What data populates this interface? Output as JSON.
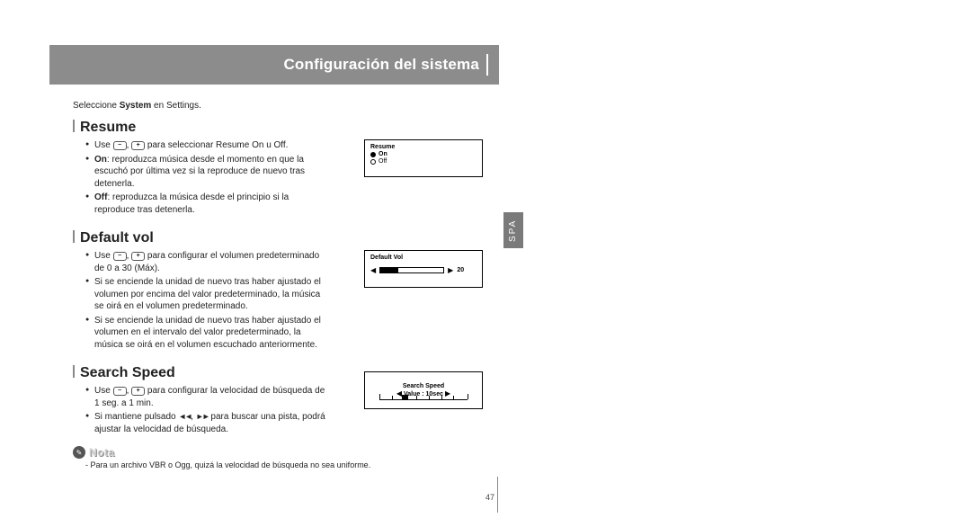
{
  "header": {
    "title": "Configuración del sistema"
  },
  "intro": {
    "prefix": "Seleccione ",
    "bold": "System",
    "suffix": " en Settings."
  },
  "spa_tab": "SPA",
  "page_number": "47",
  "icons": {
    "minus": "−",
    "plus": "+",
    "rew": "◄◄",
    "ff": "►►"
  },
  "sections": {
    "resume": {
      "title": "Resume",
      "use_prefix": "Use ",
      "use_suffix": " para seleccionar Resume On u Off.",
      "on_bold": "On",
      "on_text": ": reproduzca música desde el momento en que la escuchó por última vez si la reproduce de nuevo tras detenerla.",
      "off_bold": "Off",
      "off_text": ": reproduzca la música desde el principio si la reproduce tras detenerla.",
      "lcd": {
        "title": "Resume",
        "opt_on": "On",
        "opt_off": "Off",
        "selected": "on"
      }
    },
    "default_vol": {
      "title": "Default vol",
      "use_prefix": "Use ",
      "use_suffix": " para configurar el volumen predeterminado de 0 a 30 (Máx).",
      "b2": "Si se enciende la unidad de nuevo tras haber ajustado el volumen por encima del valor predeterminado, la música se oirá en el volumen predeterminado.",
      "b3": "Si se enciende la unidad de nuevo tras haber ajustado el volumen en el intervalo del valor predeterminado, la música se oirá en el volumen escuchado anteriormente.",
      "lcd": {
        "title": "Default Vol",
        "value_text": "20"
      }
    },
    "search_speed": {
      "title": "Search Speed",
      "use_prefix": "Use ",
      "use_suffix": " para configurar la velocidad de búsqueda de 1 seg. a 1 min.",
      "b2_prefix": "Si mantiene pulsado ",
      "b2_suffix": " para buscar una pista, podrá ajustar la velocidad de búsqueda.",
      "lcd": {
        "title": "Search Speed",
        "value_text": "Value : 10sec"
      }
    }
  },
  "note": {
    "label": "Nota",
    "text": "- Para un archivo VBR o Ogg, quizá la velocidad de búsqueda no sea uniforme."
  }
}
